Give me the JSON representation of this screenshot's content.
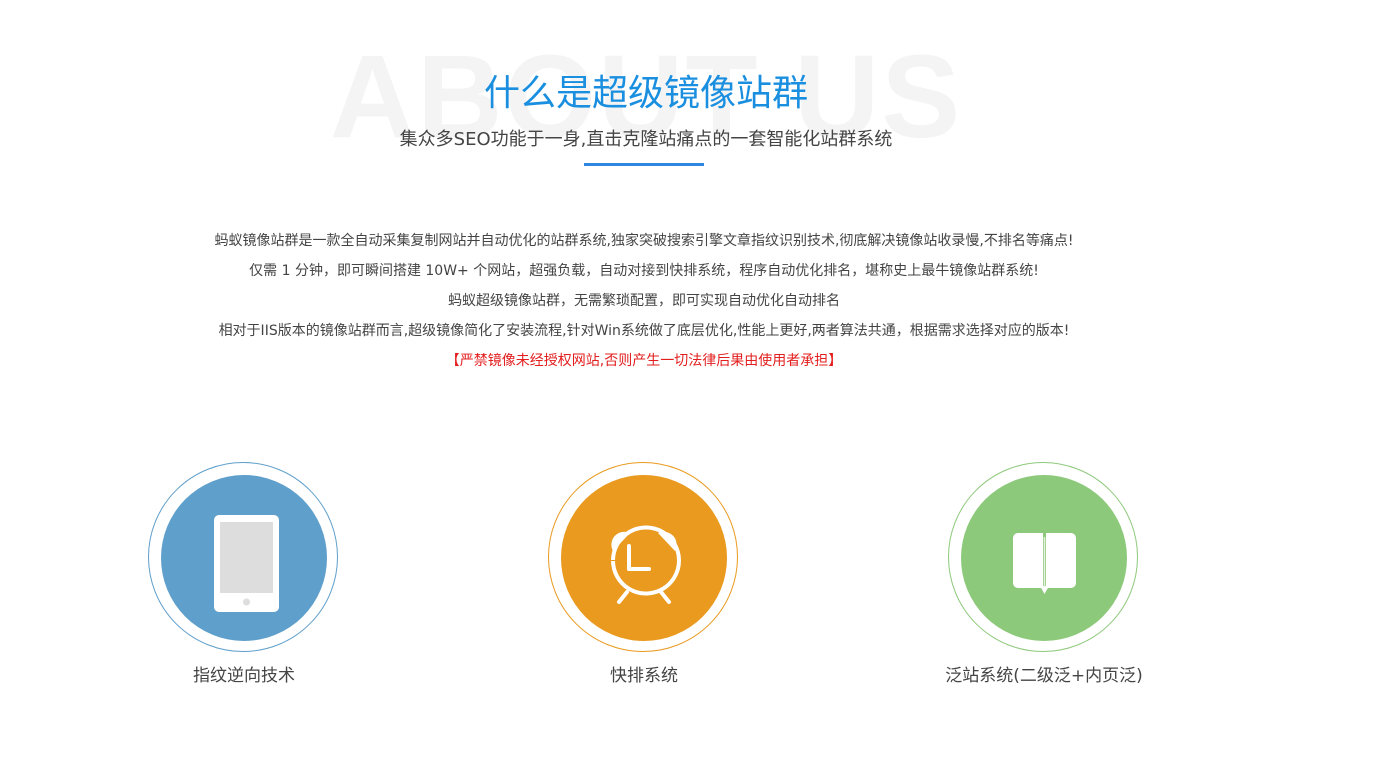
{
  "header": {
    "watermark": "ABOUT US",
    "title": "什么是超级镜像站群",
    "subtitle": "集众多SEO功能于一身,直击克隆站痛点的一套智能化站群系统"
  },
  "description": {
    "lines": [
      "蚂蚁镜像站群是一款全自动采集复制网站并自动优化的站群系统,独家突破搜索引擎文章指纹识别技术,彻底解决镜像站收录慢,不排名等痛点!",
      "仅需 1 分钟，即可瞬间搭建 10W+ 个网站，超强负载，自动对接到快排系统，程序自动优化排名，堪称史上最牛镜像站群系统!",
      "蚂蚁超级镜像站群，无需繁琐配置，即可实现自动优化自动排名",
      "相对于IIS版本的镜像站群而言,超级镜像简化了安装流程,针对Win系统做了底层优化,性能上更好,两者算法共通，根据需求选择对应的版本!"
    ],
    "warning": "【严禁镜像未经授权网站,否则产生一切法律后果由使用者承担】"
  },
  "features": [
    {
      "label": "指纹逆向技术",
      "icon": "tablet-icon",
      "color": "#5f9fcb"
    },
    {
      "label": "快排系统",
      "icon": "alarm-clock-icon",
      "color": "#e99a1f"
    },
    {
      "label": "泛站系统(二级泛+内页泛)",
      "icon": "open-book-icon",
      "color": "#8dc97a"
    }
  ],
  "colors": {
    "title": "#1a8fe0",
    "accent_line": "#2f86e0",
    "warning": "#e31e1e",
    "text": "#444444"
  }
}
